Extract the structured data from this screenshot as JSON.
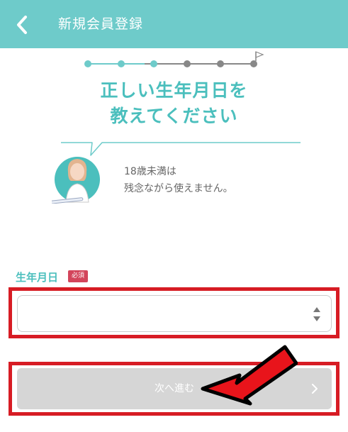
{
  "header": {
    "title": "新規会員登録",
    "back_icon": "chevron-left-icon"
  },
  "stepper": {
    "total_steps": 6,
    "completed_steps": 3,
    "goal_icon": "flag-icon"
  },
  "heading": {
    "line1": "正しい生年月日を",
    "line2": "教えてください"
  },
  "message": {
    "line1": "18歳未満は",
    "line2": "残念ながら使えません。"
  },
  "form": {
    "birthdate_label": "生年月日",
    "required_badge": "必須",
    "birthdate_value": ""
  },
  "next_button": {
    "label": "次へ進む"
  },
  "colors": {
    "header": "#6ecbca",
    "accent": "#4bbfbd",
    "required": "#d3455b",
    "highlight": "#d71c24",
    "disabled_button": "#d6d6d6"
  }
}
